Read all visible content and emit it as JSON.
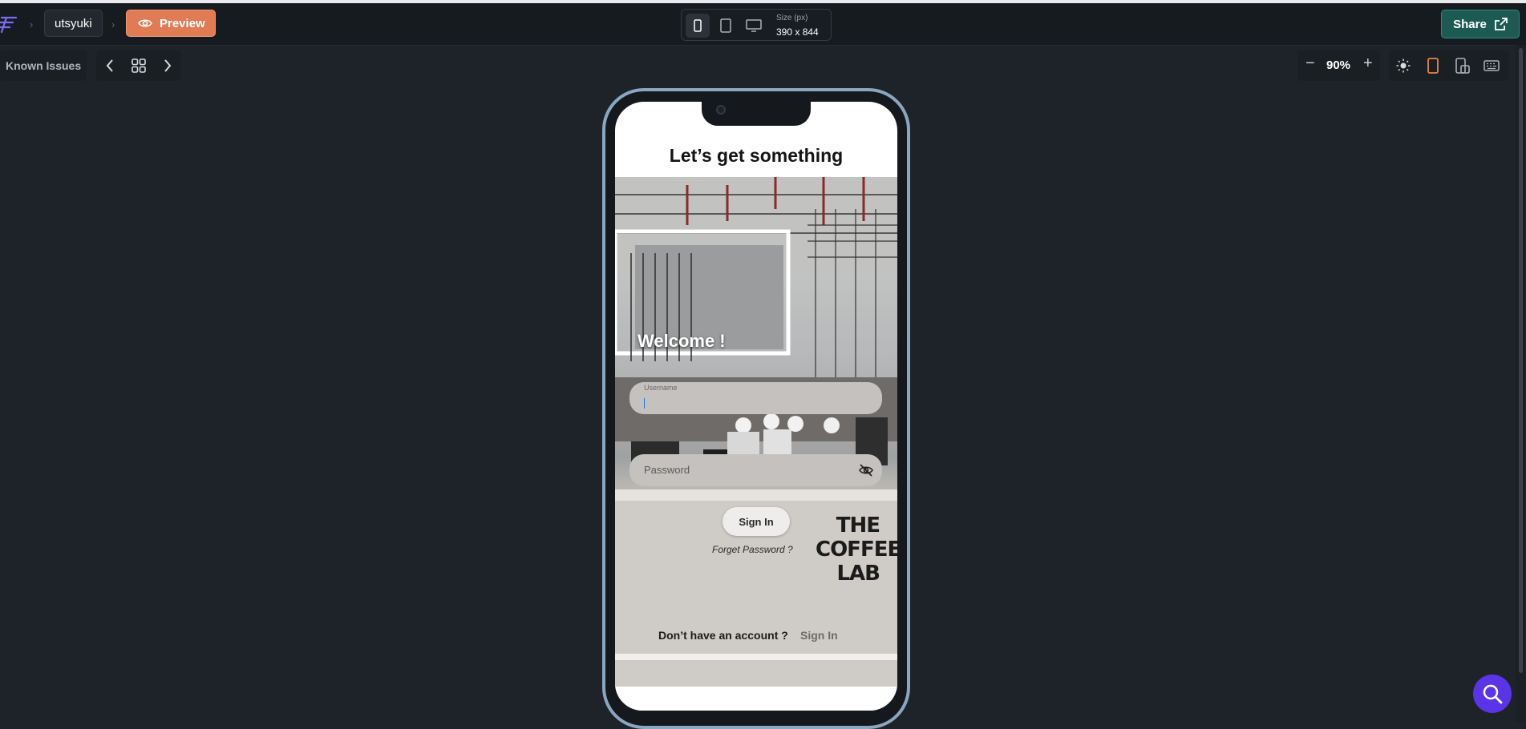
{
  "topbar": {
    "project_name": "utsyuki",
    "preview_label": "Preview",
    "size_label": "Size (px)",
    "size_value": "390 x 844",
    "share_label": "Share"
  },
  "toolbar": {
    "known_issues": "Known Issues",
    "zoom": "90%",
    "zoom_minus": "−",
    "zoom_plus": "+"
  },
  "app": {
    "headline": "Let’s get something",
    "welcome": "Welcome !",
    "username_label": "Username",
    "username_value": "",
    "password_placeholder": "Password",
    "signin_button": "Sign In",
    "forgot_password": "Forget Password ?",
    "brand": [
      "THE",
      "COFFEE",
      "LAB"
    ],
    "no_account": "Don’t have an account ?",
    "signup_link": "Sign In"
  },
  "colors": {
    "preview_accent": "#e07b55",
    "share_accent": "#1c5a53",
    "active_device": "#f0843c",
    "fab": "#5b34e8"
  }
}
